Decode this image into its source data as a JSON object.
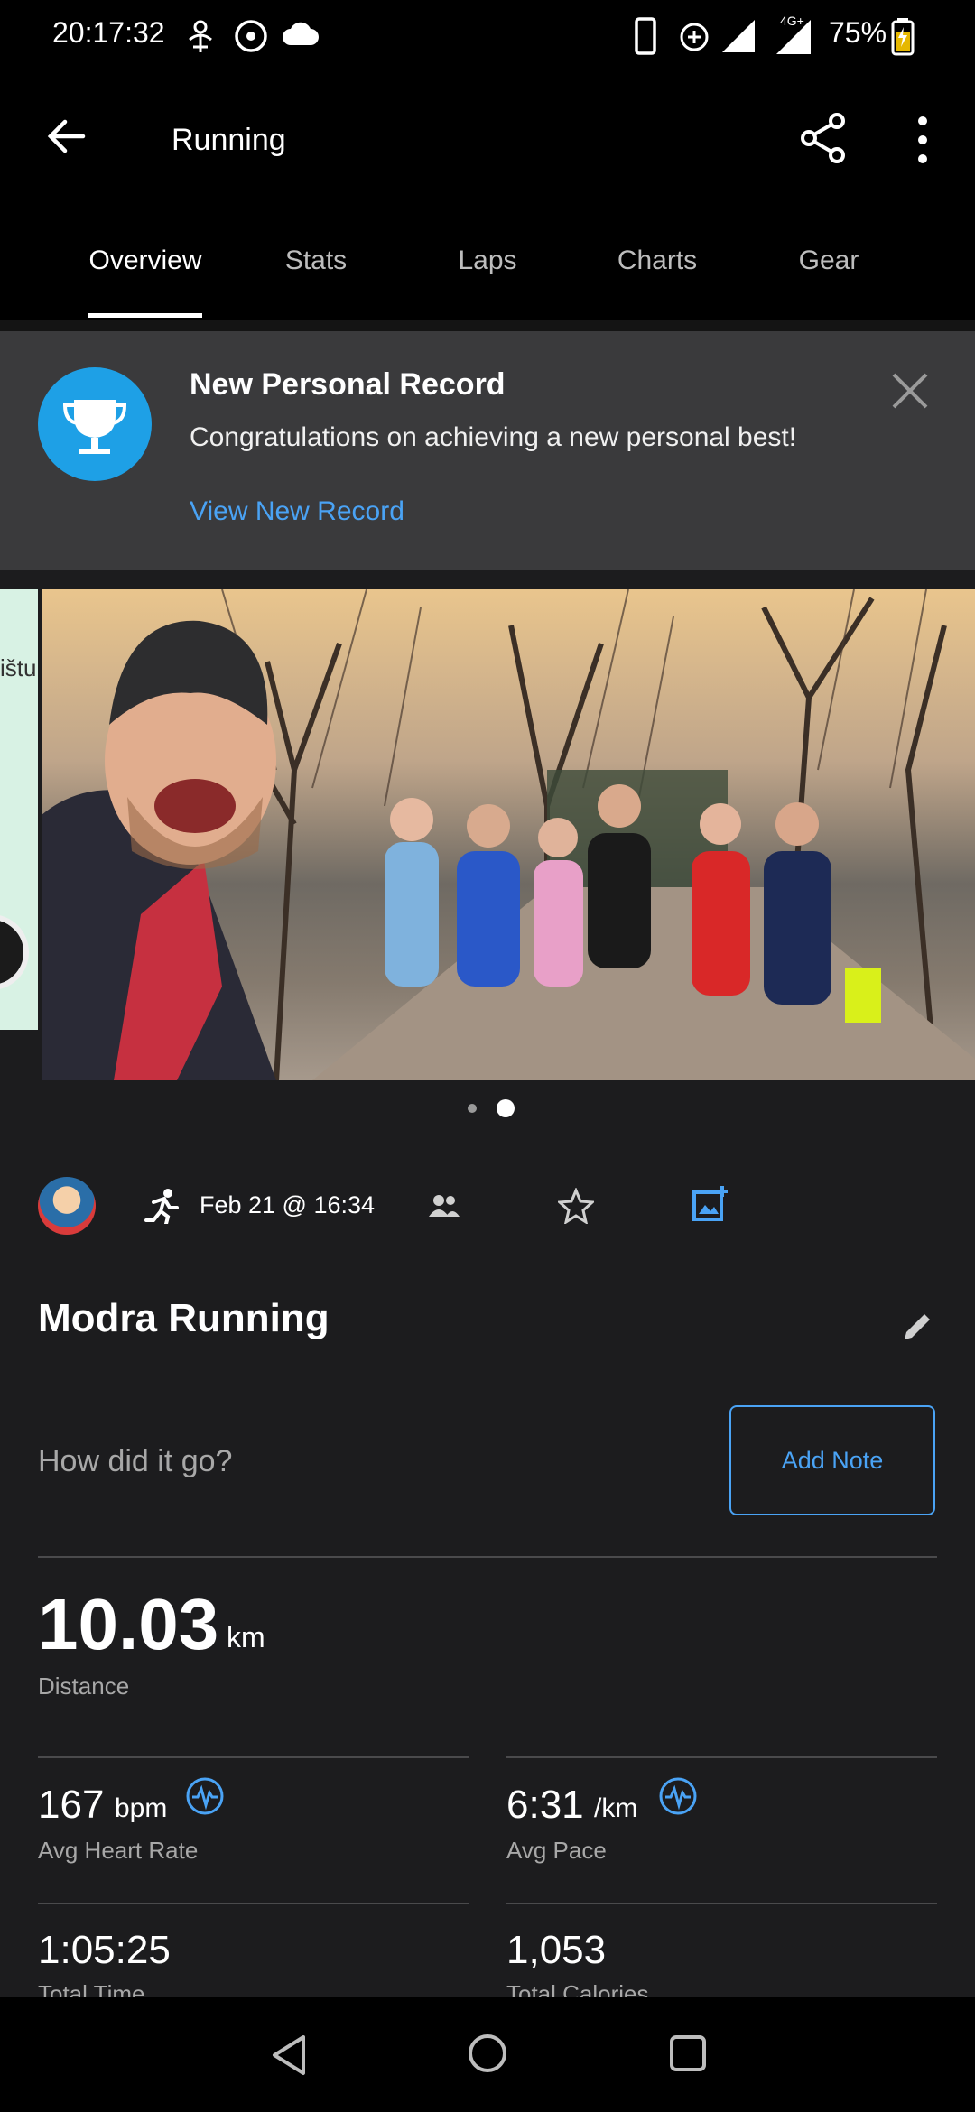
{
  "status_bar": {
    "time": "20:17:32",
    "battery": "75%"
  },
  "app_bar": {
    "title": "Running"
  },
  "tabs": [
    {
      "label": "Overview",
      "active": true
    },
    {
      "label": "Stats"
    },
    {
      "label": "Laps"
    },
    {
      "label": "Charts"
    },
    {
      "label": "Gear"
    }
  ],
  "banner": {
    "title": "New Personal Record",
    "subtitle": "Congratulations on achieving a new personal best!",
    "link": "View New Record"
  },
  "photo_carousel": {
    "map_text": "ištu",
    "pages": 2,
    "current_page": 2
  },
  "meta": {
    "date": "Feb 21 @ 16:34"
  },
  "activity": {
    "title": "Modra Running",
    "note_prompt": "How did it go?",
    "add_note_label": "Add Note"
  },
  "stats": {
    "distance": {
      "value": "10.03",
      "unit": "km",
      "label": "Distance"
    },
    "heart_rate": {
      "value": "167",
      "unit": "bpm",
      "label": "Avg Heart Rate"
    },
    "pace": {
      "value": "6:31",
      "unit": "/km",
      "label": "Avg Pace"
    },
    "time": {
      "value": "1:05:25",
      "label": "Total Time"
    },
    "calories": {
      "value": "1,053",
      "label": "Total Calories"
    }
  },
  "colors": {
    "accent": "#4aa3f5",
    "trophy": "#1ea0e6",
    "banner_bg": "#3a3a3c",
    "bg": "#1c1c1e"
  }
}
